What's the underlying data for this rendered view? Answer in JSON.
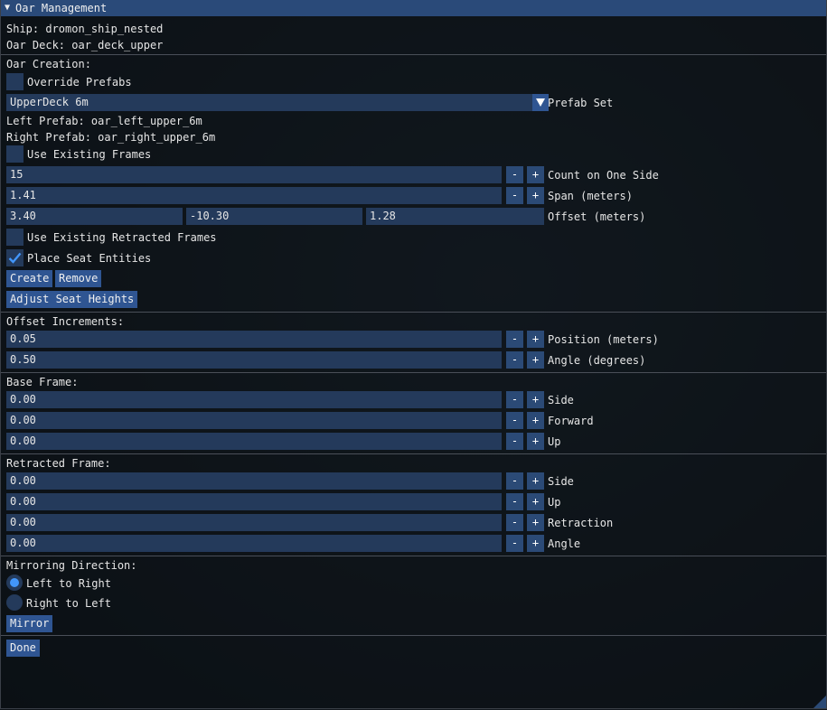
{
  "window": {
    "title": "Oar Management"
  },
  "info": {
    "ship": "Ship: dromon_ship_nested",
    "deck": "Oar Deck: oar_deck_upper"
  },
  "creation": {
    "header": "Oar Creation:",
    "override_prefabs": "Override Prefabs",
    "prefab_set_value": "UpperDeck 6m",
    "prefab_set_label": "Prefab Set",
    "left_prefab": "Left Prefab: oar_left_upper_6m",
    "right_prefab": "Right Prefab: oar_right_upper_6m",
    "use_existing_frames": "Use Existing Frames",
    "count_value": "15",
    "count_label": "Count on One Side",
    "span_value": "1.41",
    "span_label": "Span (meters)",
    "offset_x": "3.40",
    "offset_y": "-10.30",
    "offset_z": "1.28",
    "offset_label": "Offset (meters)",
    "use_existing_retracted": "Use Existing Retracted Frames",
    "place_seat_entities": "Place Seat Entities",
    "place_seat_checked": true,
    "create_button": "Create",
    "remove_button": "Remove",
    "adjust_button": "Adjust Seat Heights"
  },
  "increments": {
    "header": "Offset Increments:",
    "position_value": "0.05",
    "position_label": "Position (meters)",
    "angle_value": "0.50",
    "angle_label": "Angle (degrees)"
  },
  "base_frame": {
    "header": "Base Frame:",
    "side_value": "0.00",
    "side_label": "Side",
    "forward_value": "0.00",
    "forward_label": "Forward",
    "up_value": "0.00",
    "up_label": "Up"
  },
  "retracted_frame": {
    "header": "Retracted Frame:",
    "side_value": "0.00",
    "side_label": "Side",
    "up_value": "0.00",
    "up_label": "Up",
    "retraction_value": "0.00",
    "retraction_label": "Retraction",
    "angle_value": "0.00",
    "angle_label": "Angle"
  },
  "mirroring": {
    "header": "Mirroring Direction:",
    "left_to_right": "Left to Right",
    "right_to_left": "Right to Left",
    "mirror_button": "Mirror"
  },
  "stepper": {
    "minus": "-",
    "plus": "+"
  },
  "done_button": "Done",
  "colors": {
    "title_bar": "#2a4a79",
    "field": "#243a5b",
    "button": "#2f5592",
    "accent": "#4296fa"
  }
}
